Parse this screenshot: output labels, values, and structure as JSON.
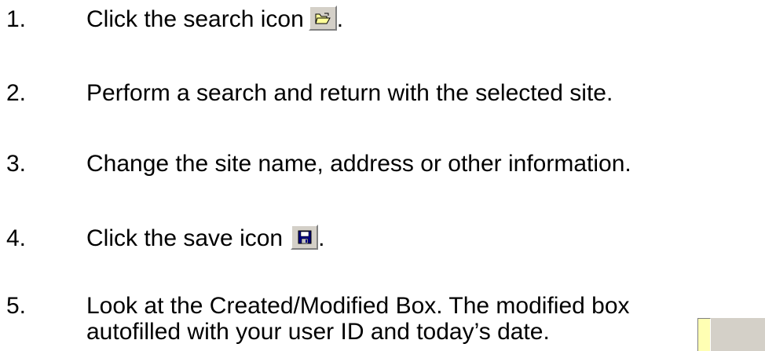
{
  "steps": [
    {
      "number": "1.",
      "text": "Click the search icon",
      "suffix": ".",
      "icon": "open-folder-icon"
    },
    {
      "number": "2.",
      "text": "Perform a search and return with the selected site."
    },
    {
      "number": "3.",
      "text": "Change the site name, address or other information."
    },
    {
      "number": "4.",
      "text": "Click the save icon",
      "suffix": ".",
      "icon": "floppy-disk-icon"
    },
    {
      "number": "5.",
      "text_line1": "Look at the Created/Modified Box. The modified box",
      "text_line2": "autofilled with your user ID and today’s date."
    }
  ],
  "colors": {
    "button_face": "#d4d0c8",
    "folder_yellow": "#ffff99",
    "floppy_blue": "#000080",
    "field_yellow": "#ffffb3"
  }
}
